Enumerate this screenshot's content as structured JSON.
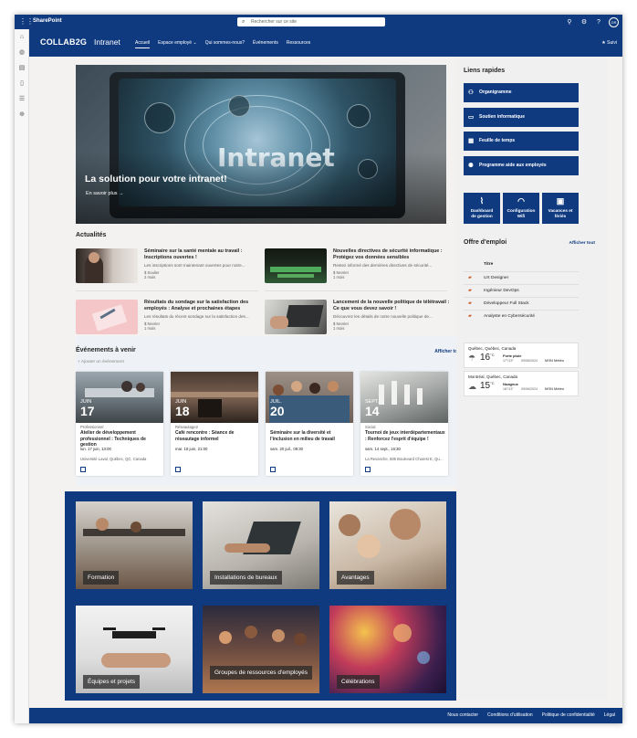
{
  "suite": {
    "app_name": "SharePoint",
    "search_placeholder": "Rechercher sur ce site",
    "avatar_initials": "GR"
  },
  "site": {
    "logo": "COLLAB2G",
    "name": "Intranet",
    "nav": [
      "Accueil",
      "Espace employé",
      "Qui sommes-nous?",
      "Événements",
      "Ressources"
    ],
    "follow_label": "Suivi"
  },
  "hero": {
    "title": "La solution pour votre intranet!",
    "link": "En savoir plus",
    "screen_word": "Intranet"
  },
  "news": {
    "heading": "Actualités",
    "items": [
      {
        "title": "Séminaire sur la santé mentale au travail : Inscriptions ouvertes !",
        "desc": "Les inscriptions sont maintenant ouvertes pour notre...",
        "author": "$ Soulier",
        "age": "2 mois"
      },
      {
        "title": "Nouvelles directives de sécurité informatique : Protégez vos données sensibles",
        "desc": "Restez informé des dernières directives de sécurité...",
        "author": "$ Nevrier",
        "age": "1 mois"
      },
      {
        "title": "Résultats du sondage sur la satisfaction des employés : Analyse et prochaines étapes",
        "desc": "Les résultats du récent sondage sur la satisfaction des...",
        "author": "$ Nevrier",
        "age": "1 mois"
      },
      {
        "title": "Lancement de la nouvelle politique de télétravail : Ce que vous devez savoir !",
        "desc": "Découvrez les détails de notre nouvelle politique de...",
        "author": "$ Nevrier",
        "age": "1 mois"
      }
    ]
  },
  "events": {
    "heading": "Événements à venir",
    "see_all": "Afficher tout",
    "add_label": "Ajouter un événement",
    "items": [
      {
        "month": "JUIN",
        "day": "17",
        "category": "Professionnel",
        "title": "Atelier de développement professionnel : Techniques de gestion",
        "when": "lun. 17 juin, 13:00",
        "where": "Université Laval, Québec, QC, Canada"
      },
      {
        "month": "JUIN",
        "day": "18",
        "category": "Réseautage2",
        "title": "Café rencontre : Séance de réseautage informel",
        "when": "mar. 18 juin, 21:00",
        "where": ""
      },
      {
        "month": "JUIL.",
        "day": "20",
        "category": "",
        "title": "Séminaire sur la diversité et l'inclusion en milieu de travail",
        "when": "sam. 20 juil., 09:30",
        "where": ""
      },
      {
        "month": "SEPT.",
        "day": "14",
        "category": "Social",
        "title": "Tournoi de jeux interdépartementaux : Renforcez l'esprit d'équipe !",
        "when": "sam. 14 sept., 16:30",
        "where": "La Revanche, 585 Boulevard Charest E, Québ..."
      }
    ]
  },
  "quick_links": {
    "heading": "Liens rapides",
    "items": [
      {
        "label": "Organigramme",
        "icon": "org-chart-icon"
      },
      {
        "label": "Soutien informatique",
        "icon": "laptop-icon"
      },
      {
        "label": "Feuille de temps",
        "icon": "timesheet-icon"
      },
      {
        "label": "Programme aide aux employés",
        "icon": "people-icon"
      }
    ],
    "tiles": [
      {
        "label_1": "Dashboard",
        "label_2": "de gestion",
        "icon": "chart-icon"
      },
      {
        "label_1": "Configuration",
        "label_2": "Wifi",
        "icon": "wifi-icon"
      },
      {
        "label_1": "Vacances et",
        "label_2": "fériés",
        "icon": "calendar-icon"
      }
    ]
  },
  "jobs": {
    "heading": "Offre d'emploi",
    "see_all": "Afficher tout",
    "column": "Titre",
    "items": [
      "UX Designer",
      "Ingénieur DevOps",
      "Développeur Full Stack",
      "Analyste en Cybersécurité"
    ]
  },
  "weather": [
    {
      "location": "Québec, Québec, Canada",
      "temp": "16",
      "unit": "°C",
      "condition": "Forte pluie",
      "range": "17°/13°",
      "date": "09/06/2024",
      "source": "MSN Météo"
    },
    {
      "location": "Montréal, Québec, Canada",
      "temp": "15",
      "unit": "°C",
      "condition": "Nuageux",
      "range": "18°/13°",
      "date": "09/06/2024",
      "source": "MSN Météo"
    }
  ],
  "big_tiles": [
    "Formation",
    "Installations de bureaux",
    "Avantages",
    "Équipes et projets",
    "Groupes de ressources d'employés",
    "Célébrations"
  ],
  "footer": [
    "Nous contacter",
    "Conditions d'utilisation",
    "Politique de confidentialité",
    "Légal"
  ],
  "colors": {
    "brand": "#0f3a80",
    "page": "#f3f2f1"
  }
}
